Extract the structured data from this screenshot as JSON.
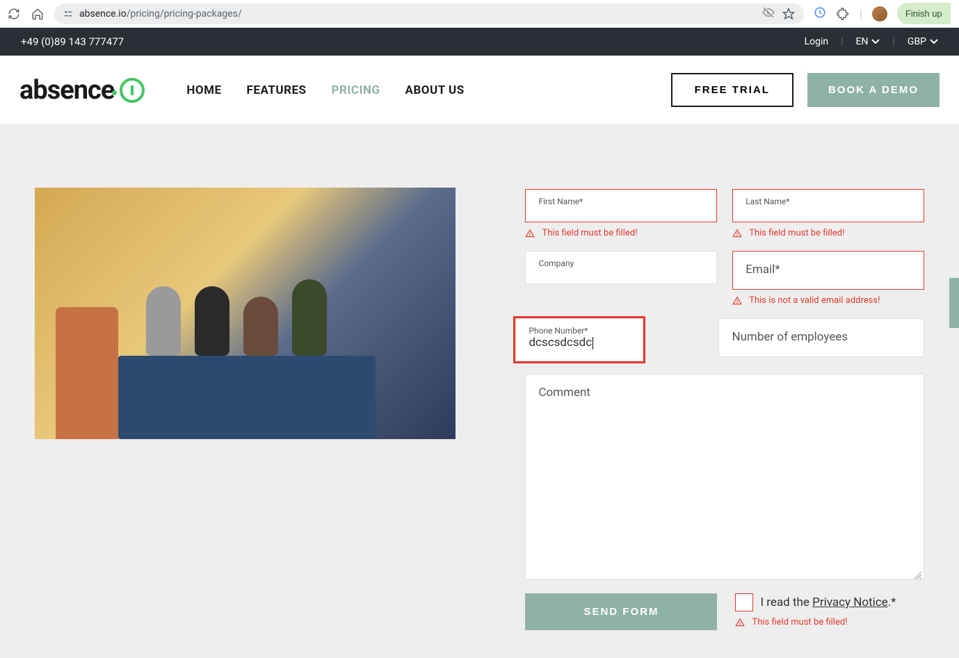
{
  "browser": {
    "url_domain": "absence.io",
    "url_path": "/pricing/pricing-packages/",
    "finish_label": "Finish up"
  },
  "topbar": {
    "phone": "+49 (0)89 143 777477",
    "login_label": "Login",
    "language": "EN",
    "currency": "GBP"
  },
  "nav": {
    "logo_text": "absence",
    "links": {
      "home": "HOME",
      "features": "FEATURES",
      "pricing": "PRICING",
      "about": "ABOUT US"
    },
    "free_trial": "FREE TRIAL",
    "book_demo": "BOOK A DEMO"
  },
  "form": {
    "first_name": {
      "label": "First Name*",
      "value": "",
      "error": "This field must be filled!"
    },
    "last_name": {
      "label": "Last Name*",
      "value": "",
      "error": "This field must be filled!"
    },
    "company": {
      "label": "Company",
      "value": ""
    },
    "email": {
      "label": "Email*",
      "value": "",
      "error": "This is not a valid email address!"
    },
    "phone": {
      "label": "Phone Number*",
      "value": "dcscsdcsdc"
    },
    "employees": {
      "placeholder": "Number of employees",
      "value": ""
    },
    "comment": {
      "placeholder": "Comment",
      "value": ""
    },
    "send_label": "SEND FORM",
    "privacy": {
      "prefix": "I read the ",
      "link": "Privacy Notice",
      "suffix": ".*",
      "error": "This field must be filled!"
    }
  }
}
